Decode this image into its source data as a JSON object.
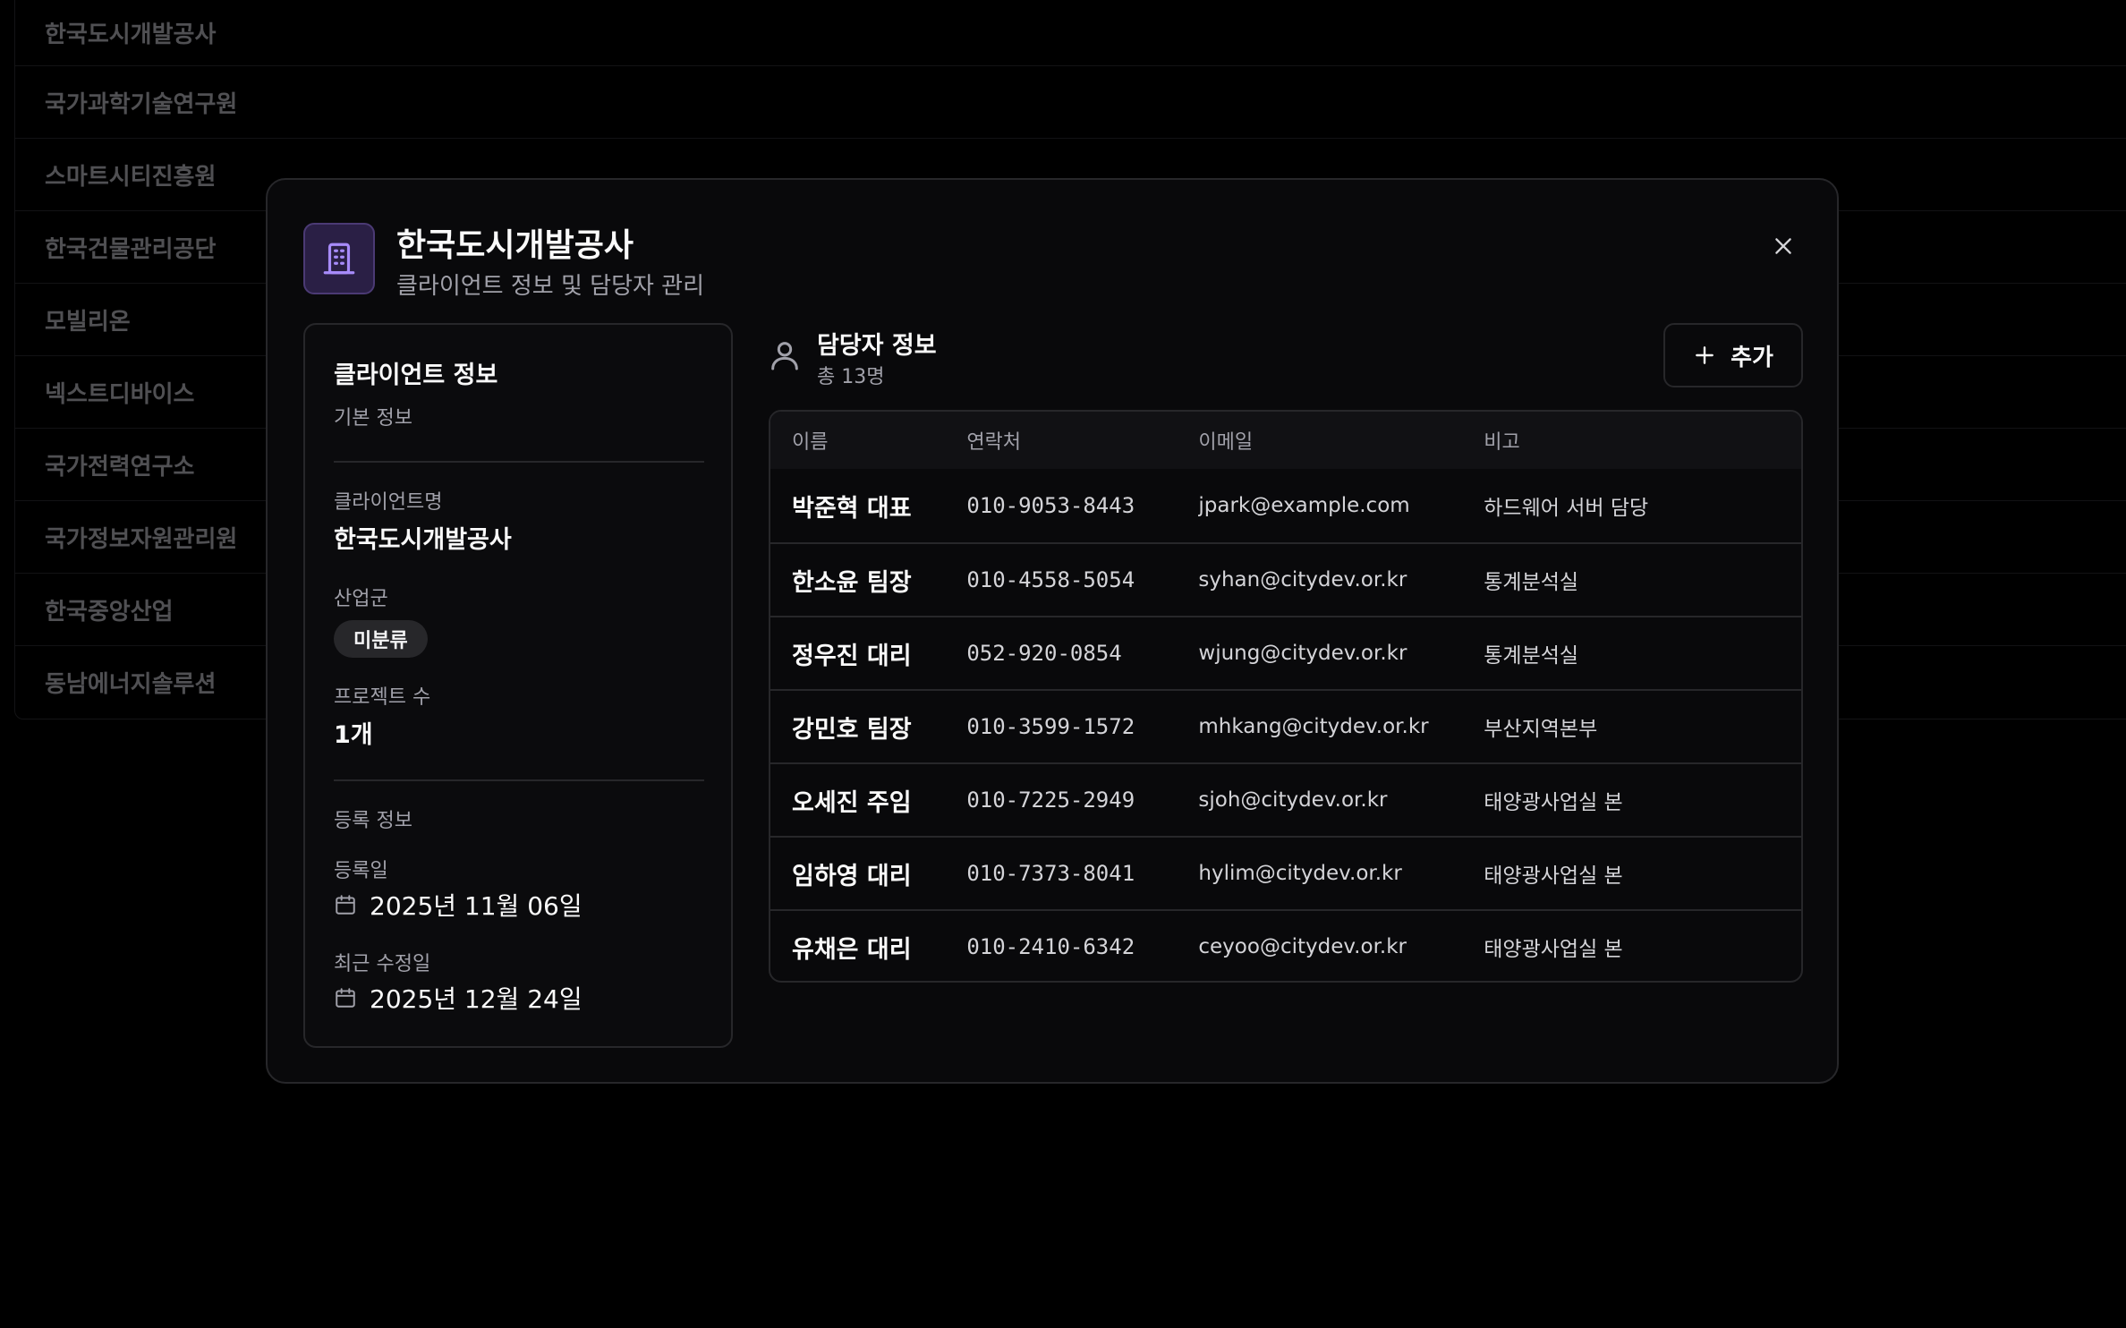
{
  "background_list": [
    "한국도시개발공사",
    "국가과학기술연구원",
    "스마트시티진흥원",
    "한국건물관리공단",
    "모빌리온",
    "넥스트디바이스",
    "국가전력연구소",
    "국가정보자원관리원",
    "한국중앙산업",
    "동남에너지솔루션"
  ],
  "modal": {
    "title": "한국도시개발공사",
    "subtitle": "클라이언트 정보 및 담당자 관리",
    "header_icon": "building-icon",
    "close_icon": "close-icon"
  },
  "client_info": {
    "title": "클라이언트 정보",
    "section_basic": "기본 정보",
    "name_label": "클라이언트명",
    "name_value": "한국도시개발공사",
    "industry_label": "산업군",
    "industry_value": "미분류",
    "projects_label": "프로젝트 수",
    "projects_value": "1개",
    "section_registration": "등록 정보",
    "registered_label": "등록일",
    "registered_value": "2025년 11월 06일",
    "modified_label": "최근 수정일",
    "modified_value": "2025년 12월 24일"
  },
  "contacts": {
    "title": "담당자 정보",
    "count": "총 13명",
    "add_label": "추가",
    "columns": [
      "이름",
      "연락처",
      "이메일",
      "비고"
    ],
    "rows": [
      {
        "name": "박준혁 대표",
        "phone": "010-9053-8443",
        "email": "jpark@example.com",
        "note": "하드웨어 서버 담당"
      },
      {
        "name": "한소윤 팀장",
        "phone": "010-4558-5054",
        "email": "syhan@citydev.or.kr",
        "note": "통계분석실"
      },
      {
        "name": "정우진 대리",
        "phone": "052-920-0854",
        "email": "wjung@citydev.or.kr",
        "note": "통계분석실"
      },
      {
        "name": "강민호 팀장",
        "phone": "010-3599-1572",
        "email": "mhkang@citydev.or.kr",
        "note": "부산지역본부"
      },
      {
        "name": "오세진 주임",
        "phone": "010-7225-2949",
        "email": "sjoh@citydev.or.kr",
        "note": "태양광사업실 본"
      },
      {
        "name": "임하영 대리",
        "phone": "010-7373-8041",
        "email": "hylim@citydev.or.kr",
        "note": "태양광사업실 본"
      },
      {
        "name": "유채은 대리",
        "phone": "010-2410-6342",
        "email": "ceyoo@citydev.or.kr",
        "note": "태양광사업실 본"
      }
    ]
  },
  "colors": {
    "accent_purple": "#a78bfa",
    "background": "#000000",
    "modal_bg": "#09090b"
  }
}
